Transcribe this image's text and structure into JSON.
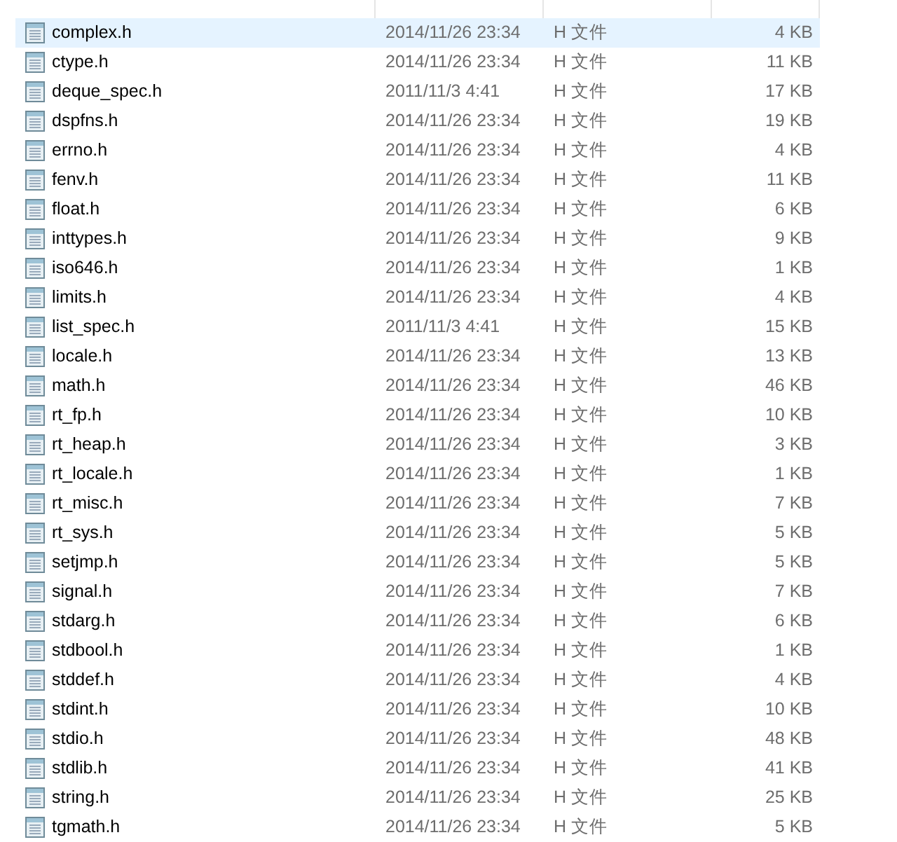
{
  "files": [
    {
      "name": "complex.h",
      "modified": "2014/11/26 23:34",
      "type": "H 文件",
      "size": "4 KB",
      "selected": true
    },
    {
      "name": "ctype.h",
      "modified": "2014/11/26 23:34",
      "type": "H 文件",
      "size": "11 KB",
      "selected": false
    },
    {
      "name": "deque_spec.h",
      "modified": "2011/11/3 4:41",
      "type": "H 文件",
      "size": "17 KB",
      "selected": false
    },
    {
      "name": "dspfns.h",
      "modified": "2014/11/26 23:34",
      "type": "H 文件",
      "size": "19 KB",
      "selected": false
    },
    {
      "name": "errno.h",
      "modified": "2014/11/26 23:34",
      "type": "H 文件",
      "size": "4 KB",
      "selected": false
    },
    {
      "name": "fenv.h",
      "modified": "2014/11/26 23:34",
      "type": "H 文件",
      "size": "11 KB",
      "selected": false
    },
    {
      "name": "float.h",
      "modified": "2014/11/26 23:34",
      "type": "H 文件",
      "size": "6 KB",
      "selected": false
    },
    {
      "name": "inttypes.h",
      "modified": "2014/11/26 23:34",
      "type": "H 文件",
      "size": "9 KB",
      "selected": false
    },
    {
      "name": "iso646.h",
      "modified": "2014/11/26 23:34",
      "type": "H 文件",
      "size": "1 KB",
      "selected": false
    },
    {
      "name": "limits.h",
      "modified": "2014/11/26 23:34",
      "type": "H 文件",
      "size": "4 KB",
      "selected": false
    },
    {
      "name": "list_spec.h",
      "modified": "2011/11/3 4:41",
      "type": "H 文件",
      "size": "15 KB",
      "selected": false
    },
    {
      "name": "locale.h",
      "modified": "2014/11/26 23:34",
      "type": "H 文件",
      "size": "13 KB",
      "selected": false
    },
    {
      "name": "math.h",
      "modified": "2014/11/26 23:34",
      "type": "H 文件",
      "size": "46 KB",
      "selected": false
    },
    {
      "name": "rt_fp.h",
      "modified": "2014/11/26 23:34",
      "type": "H 文件",
      "size": "10 KB",
      "selected": false
    },
    {
      "name": "rt_heap.h",
      "modified": "2014/11/26 23:34",
      "type": "H 文件",
      "size": "3 KB",
      "selected": false
    },
    {
      "name": "rt_locale.h",
      "modified": "2014/11/26 23:34",
      "type": "H 文件",
      "size": "1 KB",
      "selected": false
    },
    {
      "name": "rt_misc.h",
      "modified": "2014/11/26 23:34",
      "type": "H 文件",
      "size": "7 KB",
      "selected": false
    },
    {
      "name": "rt_sys.h",
      "modified": "2014/11/26 23:34",
      "type": "H 文件",
      "size": "5 KB",
      "selected": false
    },
    {
      "name": "setjmp.h",
      "modified": "2014/11/26 23:34",
      "type": "H 文件",
      "size": "5 KB",
      "selected": false
    },
    {
      "name": "signal.h",
      "modified": "2014/11/26 23:34",
      "type": "H 文件",
      "size": "7 KB",
      "selected": false
    },
    {
      "name": "stdarg.h",
      "modified": "2014/11/26 23:34",
      "type": "H 文件",
      "size": "6 KB",
      "selected": false
    },
    {
      "name": "stdbool.h",
      "modified": "2014/11/26 23:34",
      "type": "H 文件",
      "size": "1 KB",
      "selected": false
    },
    {
      "name": "stddef.h",
      "modified": "2014/11/26 23:34",
      "type": "H 文件",
      "size": "4 KB",
      "selected": false
    },
    {
      "name": "stdint.h",
      "modified": "2014/11/26 23:34",
      "type": "H 文件",
      "size": "10 KB",
      "selected": false
    },
    {
      "name": "stdio.h",
      "modified": "2014/11/26 23:34",
      "type": "H 文件",
      "size": "48 KB",
      "selected": false
    },
    {
      "name": "stdlib.h",
      "modified": "2014/11/26 23:34",
      "type": "H 文件",
      "size": "41 KB",
      "selected": false
    },
    {
      "name": "string.h",
      "modified": "2014/11/26 23:34",
      "type": "H 文件",
      "size": "25 KB",
      "selected": false
    },
    {
      "name": "tgmath.h",
      "modified": "2014/11/26 23:34",
      "type": "H 文件",
      "size": "5 KB",
      "selected": false
    }
  ]
}
